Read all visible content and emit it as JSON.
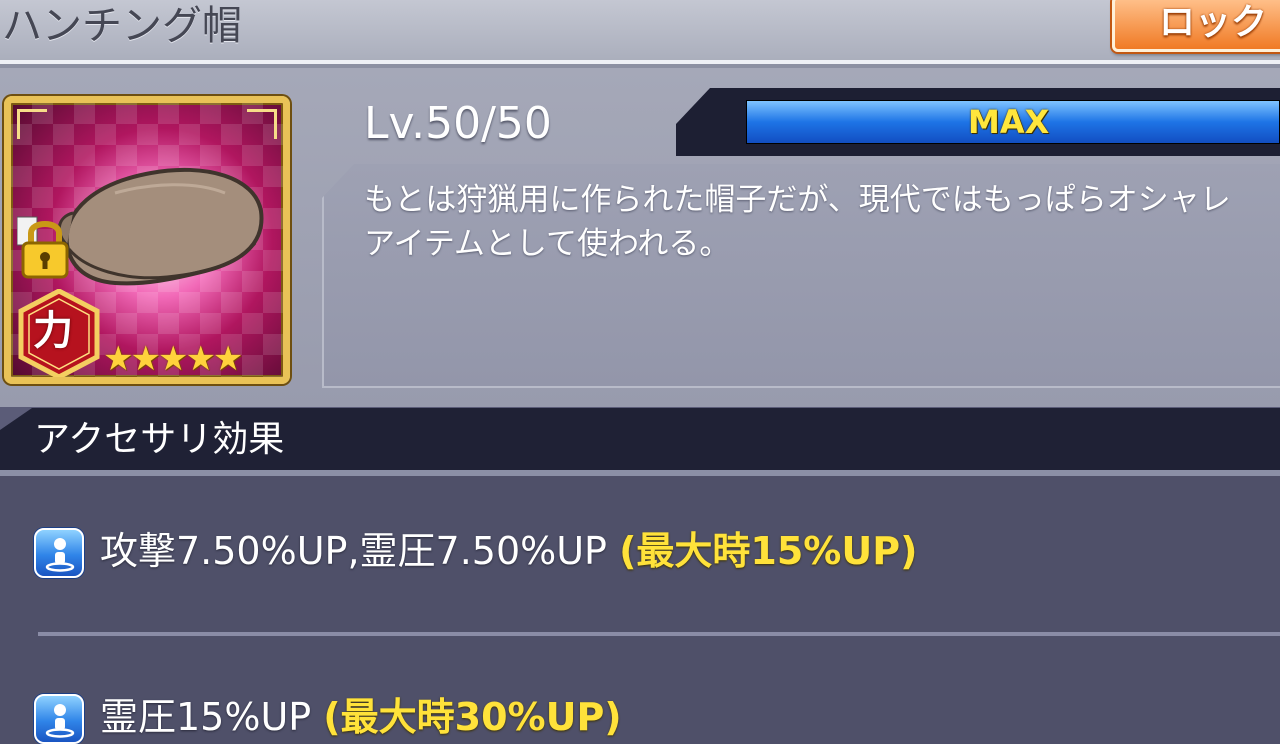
{
  "header": {
    "item_name": "ハンチング帽",
    "lock_button_label": "ロック"
  },
  "item": {
    "icon": "hunting-cap-icon",
    "rarity_stars": "★★★★★",
    "rarity": 5,
    "attribute": "力",
    "locked": true,
    "level_text": "Lv.50/50",
    "exp_bar_label": "MAX",
    "exp_progress": 1.0,
    "description": "もとは狩猟用に作られた帽子だが、現代ではもっぱらオシャレアイテムとして使われる。"
  },
  "effects_section": {
    "title": "アクセサリ効果",
    "effects": [
      {
        "icon": "effect-self-icon",
        "text": "攻撃7.50%UP,霊圧7.50%UP ",
        "max_text": "(最大時15%UP)"
      },
      {
        "icon": "effect-self-icon",
        "text": "霊圧15%UP ",
        "max_text": "(最大時30%UP)"
      }
    ]
  },
  "colors": {
    "accent_orange": "#f07a25",
    "exp_bar_blue": "#1e74e6",
    "max_text_yellow": "#ffe23a"
  }
}
